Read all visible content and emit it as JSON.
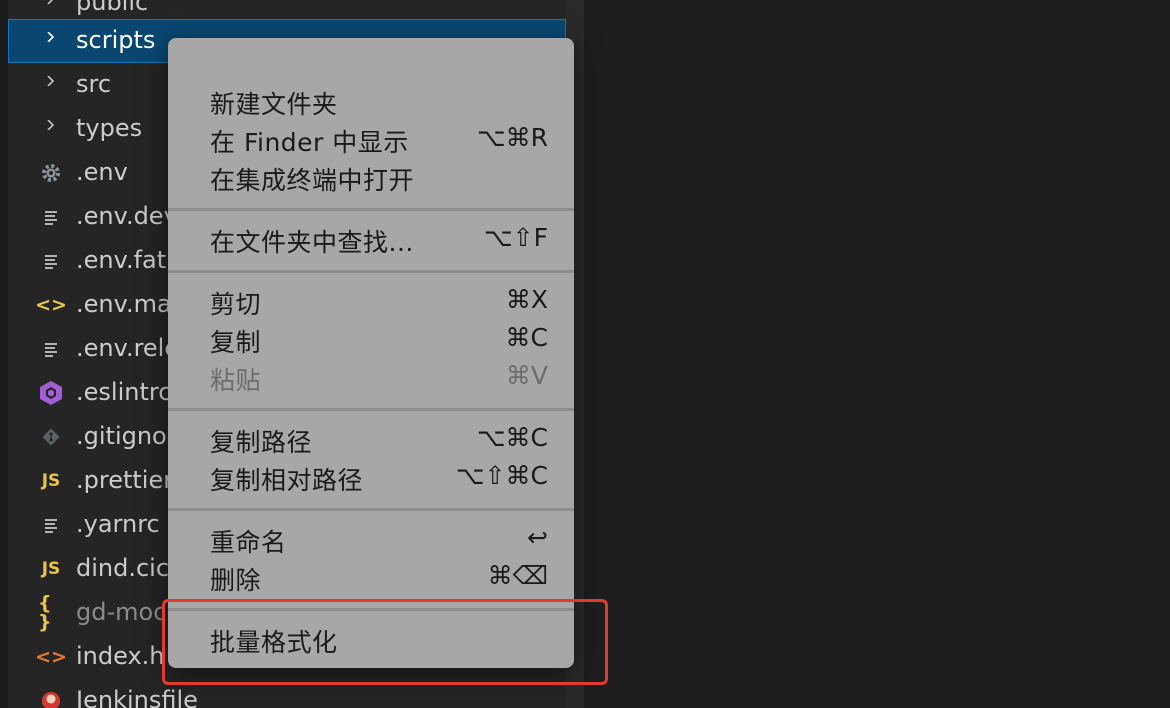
{
  "explorer": {
    "items": [
      {
        "name": "public",
        "kind": "folder"
      },
      {
        "name": "scripts",
        "kind": "folder",
        "selected": true
      },
      {
        "name": "src",
        "kind": "folder"
      },
      {
        "name": "types",
        "kind": "folder"
      },
      {
        "name": ".env",
        "kind": "gear-file"
      },
      {
        "name": ".env.dev",
        "kind": "text-file"
      },
      {
        "name": ".env.fat",
        "kind": "text-file"
      },
      {
        "name": ".env.ma",
        "kind": "code-file"
      },
      {
        "name": ".env.rele",
        "kind": "text-file"
      },
      {
        "name": ".eslintrc",
        "kind": "eslint-file"
      },
      {
        "name": ".gitigno",
        "kind": "git-file"
      },
      {
        "name": ".prettier",
        "kind": "js-file"
      },
      {
        "name": ".yarnrc",
        "kind": "text-file"
      },
      {
        "name": "dind.cic",
        "kind": "js-file"
      },
      {
        "name": "gd-moc",
        "kind": "json-file",
        "muted": true
      },
      {
        "name": "index.h",
        "kind": "html-file"
      },
      {
        "name": "Jenkinsfile",
        "kind": "jenkins-file"
      }
    ],
    "icons": {
      "js_label": "JS",
      "json_label": "{ }",
      "code_label": "<>"
    }
  },
  "context_menu": {
    "items": {
      "new_folder": {
        "label": "新建文件夹",
        "shortcut": ""
      },
      "reveal_finder": {
        "label": "在 Finder 中显示",
        "shortcut": "⌥⌘R"
      },
      "open_terminal": {
        "label": "在集成终端中打开",
        "shortcut": ""
      },
      "find_in_folder": {
        "label": "在文件夹中查找...",
        "shortcut": "⌥⇧F"
      },
      "cut": {
        "label": "剪切",
        "shortcut": "⌘X"
      },
      "copy": {
        "label": "复制",
        "shortcut": "⌘C"
      },
      "paste": {
        "label": "粘贴",
        "shortcut": "⌘V",
        "disabled": true
      },
      "copy_path": {
        "label": "复制路径",
        "shortcut": "⌥⌘C"
      },
      "copy_relative_path": {
        "label": "复制相对路径",
        "shortcut": "⌥⇧⌘C"
      },
      "rename": {
        "label": "重命名",
        "shortcut": "↩"
      },
      "delete": {
        "label": "删除",
        "shortcut": "⌘⌫"
      },
      "batch_format": {
        "label": "批量格式化",
        "shortcut": ""
      }
    }
  },
  "colors": {
    "highlight_box": "#e03b2f",
    "selection": "#094771",
    "menu_bg": "#a7a7a7"
  }
}
